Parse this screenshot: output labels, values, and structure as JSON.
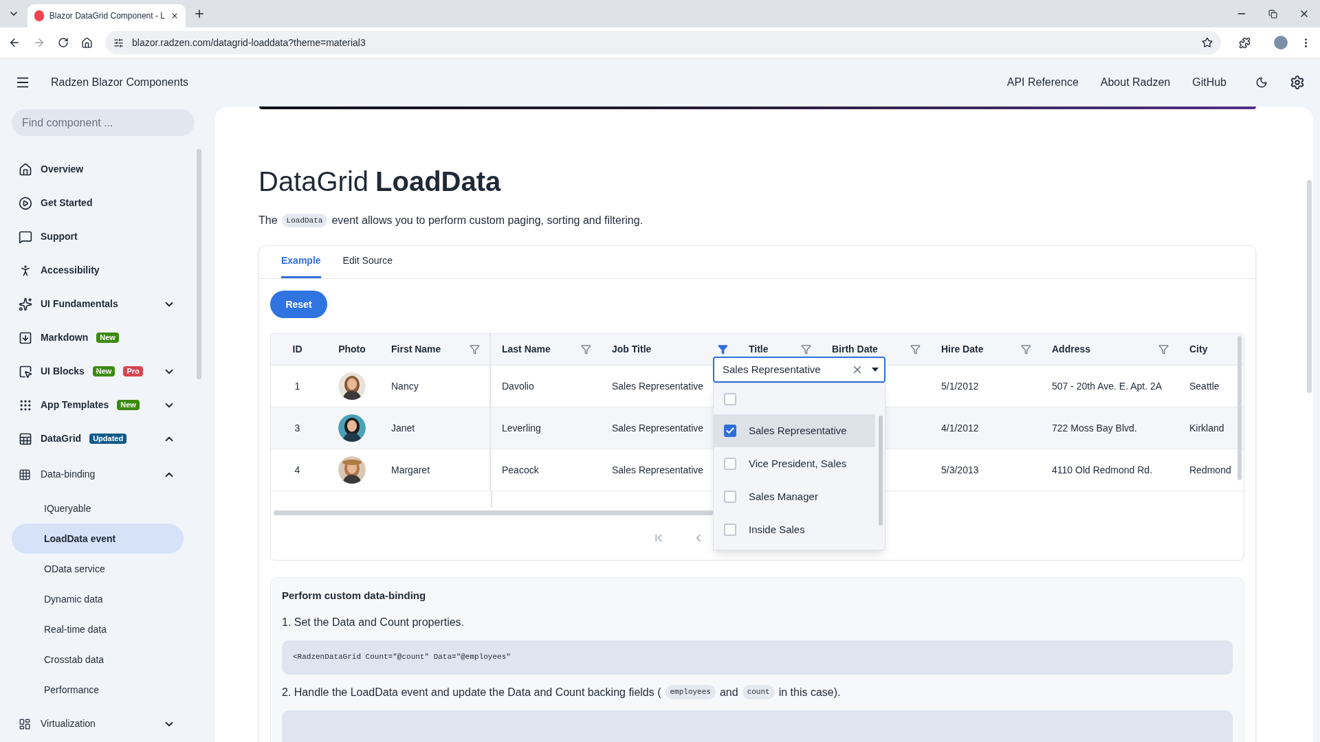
{
  "browser": {
    "tab_title": "Blazor DataGrid Component - L",
    "url": "blazor.radzen.com/datagrid-loaddata?theme=material3"
  },
  "header": {
    "title": "Radzen Blazor Components",
    "links": [
      "API Reference",
      "About Radzen",
      "GitHub"
    ]
  },
  "sidebar": {
    "search_placeholder": "Find component ...",
    "items": [
      {
        "label": "Overview",
        "selected": false
      },
      {
        "label": "Get Started",
        "selected": false
      },
      {
        "label": "Support",
        "selected": false
      },
      {
        "label": "Accessibility",
        "selected": false
      },
      {
        "label": "UI Fundamentals",
        "expanded": false
      },
      {
        "label": "Markdown",
        "selected": false,
        "badges": [
          {
            "text": "New",
            "color": "#3b8a0f"
          }
        ]
      },
      {
        "label": "UI Blocks",
        "expanded": false,
        "badges": [
          {
            "text": "New",
            "color": "#3b8a0f"
          },
          {
            "text": "Pro",
            "color": "#d64550"
          }
        ]
      },
      {
        "label": "App Templates",
        "expanded": false,
        "badges": [
          {
            "text": "New",
            "color": "#3b8a0f"
          }
        ]
      },
      {
        "label": "DataGrid",
        "expanded": true,
        "badges": [
          {
            "text": "Updated",
            "color": "#0e5a8a"
          }
        ],
        "children": [
          {
            "label": "Data-binding",
            "expanded": true,
            "children": [
              {
                "label": "IQueryable",
                "selected": false
              },
              {
                "label": "LoadData event",
                "selected": true
              },
              {
                "label": "OData service",
                "selected": false
              },
              {
                "label": "Dynamic data",
                "selected": false
              },
              {
                "label": "Real-time data",
                "selected": false
              },
              {
                "label": "Crosstab data",
                "selected": false
              },
              {
                "label": "Performance",
                "selected": false
              }
            ]
          },
          {
            "label": "Virtualization",
            "expanded": false
          }
        ]
      }
    ]
  },
  "page": {
    "title_light": "DataGrid",
    "title_bold": "LoadData",
    "description": [
      {
        "kind": "text",
        "text": "The"
      },
      {
        "kind": "code",
        "text": "LoadData"
      },
      {
        "kind": "text",
        "text": "event allows you to perform custom paging, sorting and filtering."
      }
    ]
  },
  "tabs": [
    {
      "label": "Example",
      "selected": true
    },
    {
      "label": "Edit Source",
      "selected": false
    }
  ],
  "reset_button": "Reset",
  "grid": {
    "columns": [
      {
        "label": "ID",
        "kind": "text",
        "filterable": false
      },
      {
        "label": "Photo",
        "filterable": false
      },
      {
        "label": "First Name",
        "kind": "text",
        "filterable": true,
        "filter_active": false
      },
      {
        "label": "Last Name",
        "kind": "text",
        "filterable": true,
        "filter_active": false
      },
      {
        "label": "Job Title",
        "kind": "text",
        "filterable": true,
        "filter_active": true
      },
      {
        "label": "Title",
        "kind": "text",
        "filterable": true,
        "filter_active": false
      },
      {
        "label": "Birth Date",
        "kind": "text",
        "filterable": true,
        "filter_active": false
      },
      {
        "label": "Hire Date",
        "kind": "text",
        "filterable": true,
        "filter_active": false
      },
      {
        "label": "Address",
        "kind": "text",
        "filterable": true,
        "filter_active": false
      },
      {
        "label": "City",
        "kind": "text",
        "filterable": false
      }
    ],
    "rows": [
      {
        "cells": [
          "1",
          null,
          "Nancy",
          "Davolio",
          "Sales Representative",
          null,
          null,
          "5/1/2012",
          "507 - 20th Ave. E. Apt. 2A",
          "Seattle"
        ]
      },
      {
        "cells": [
          "3",
          null,
          "Janet",
          "Leverling",
          "Sales Representative",
          null,
          null,
          "4/1/2012",
          "722 Moss Bay Blvd.",
          "Kirkland"
        ]
      },
      {
        "cells": [
          "4",
          null,
          "Margaret",
          "Peacock",
          "Sales Representative",
          null,
          null,
          "5/3/2013",
          "4110 Old Redmond Rd.",
          "Redmond"
        ]
      }
    ],
    "filter_popup": {
      "value": "Sales Representative",
      "select_all": {
        "checked": false
      },
      "options": [
        {
          "label": "Sales Representative",
          "checked": true,
          "selected": true
        },
        {
          "label": "Vice President, Sales",
          "checked": false,
          "selected": false
        },
        {
          "label": "Sales Manager",
          "checked": false,
          "selected": false
        },
        {
          "label": "Inside Sales",
          "checked": false,
          "selected": false
        }
      ]
    }
  },
  "doc": {
    "heading": "Perform custom data-binding",
    "step1": "1. Set the Data and Count properties.",
    "code1": "<RadzenDataGrid Count=\"@count\" Data=\"@employees\"",
    "step2": [
      {
        "kind": "text",
        "text": "2. Handle the LoadData event and update the Data and Count backing fields ("
      },
      {
        "kind": "code",
        "text": "employees"
      },
      {
        "kind": "text",
        "text": "and"
      },
      {
        "kind": "code",
        "text": "count"
      },
      {
        "kind": "text",
        "text": "in this case)."
      }
    ]
  }
}
